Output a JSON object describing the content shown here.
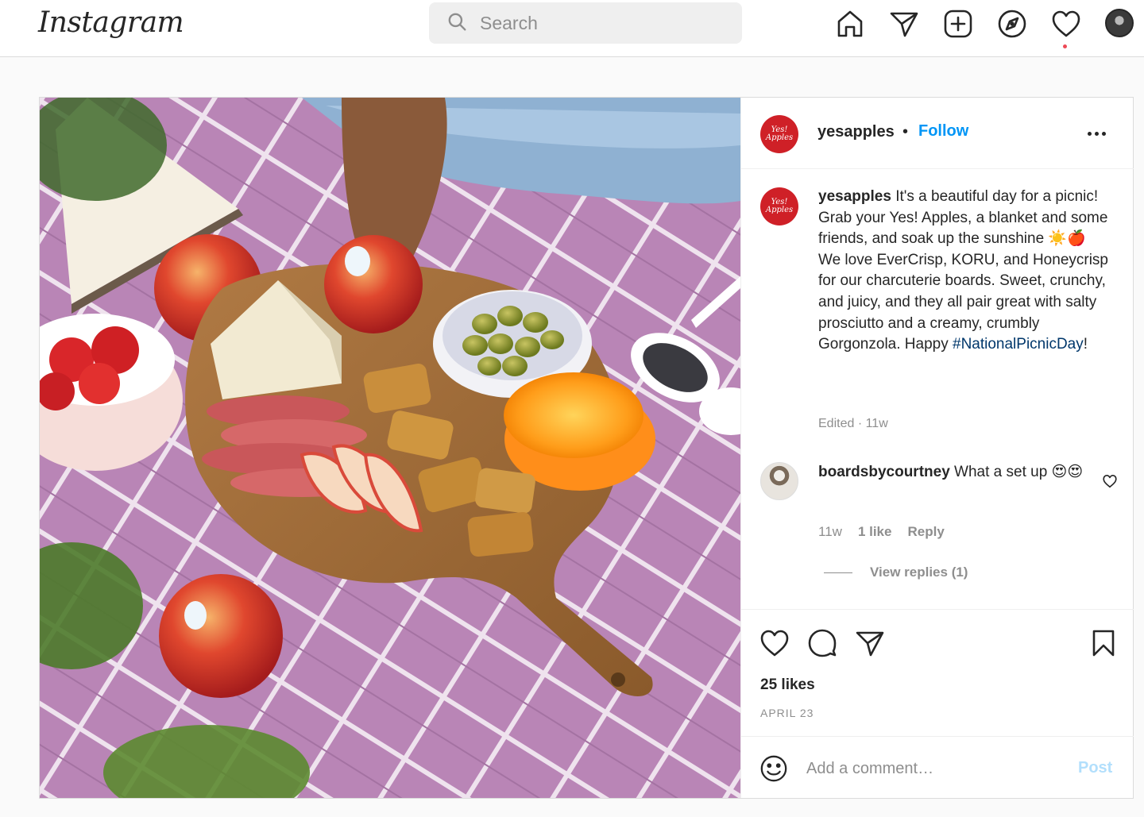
{
  "header": {
    "logo_text": "Instagram",
    "search_placeholder": "Search",
    "icons": [
      "home-icon",
      "direct-icon",
      "new-post-icon",
      "explore-icon",
      "activity-heart-icon",
      "profile-avatar"
    ]
  },
  "post": {
    "image_alt": "Picnic charcuterie board with Yes! Apples, cheese, olives, crackers and orange on a purple plaid blanket",
    "header": {
      "username": "yesapples",
      "separator": "•",
      "follow_label": "Follow",
      "avatar_text": "Yes! Apples"
    },
    "caption": {
      "username": "yesapples",
      "text": "It's a beautiful day for a picnic! Grab your Yes! Apples, a blanket and some friends, and soak up the sunshine ☀️🍎 We love EverCrisp, KORU, and Honeycrisp for our charcuterie boards. Sweet, crunchy, and juicy, and they all pair great with salty prosciutto and a creamy, crumbly Gorgonzola. Happy ",
      "hashtag": "#NationalPicnicDay",
      "tail": "!",
      "meta": "Edited · 11w"
    },
    "comment": {
      "username": "boardsbycourtney",
      "text": "What a set up 😍😍",
      "time": "11w",
      "likes": "1 like",
      "reply_label": "Reply",
      "view_replies": "View replies (1)"
    },
    "likes": "25 likes",
    "date": "APRIL 23",
    "add_comment": {
      "placeholder": "Add a comment…",
      "post_label": "Post"
    }
  },
  "colors": {
    "accent": "#0095f6",
    "brand_red": "#cf2027",
    "muted": "#8e8e8e",
    "post_disabled": "#b2dffc"
  }
}
